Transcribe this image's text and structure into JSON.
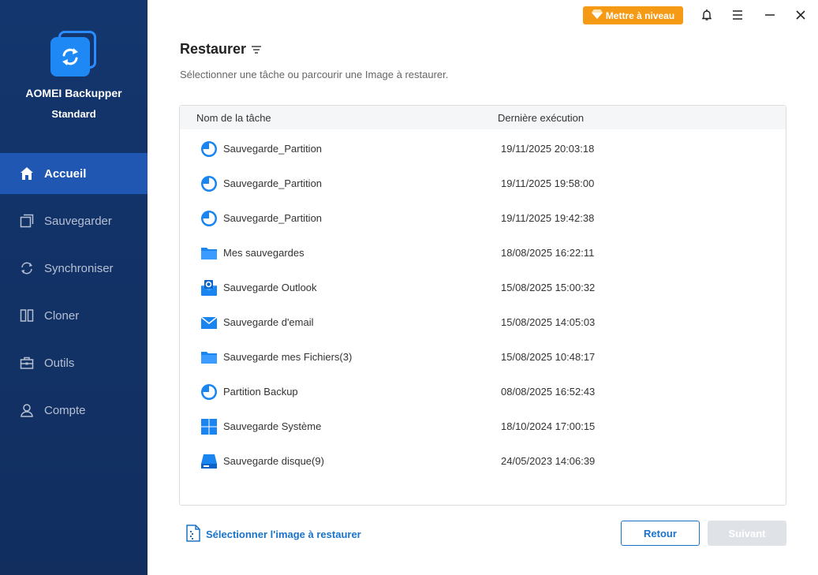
{
  "app": {
    "name": "AOMEI Backupper",
    "edition": "Standard"
  },
  "nav": [
    {
      "label": "Accueil",
      "icon": "home-icon",
      "active": true
    },
    {
      "label": "Sauvegarder",
      "icon": "backup-icon"
    },
    {
      "label": "Synchroniser",
      "icon": "sync-icon"
    },
    {
      "label": "Cloner",
      "icon": "clone-icon"
    },
    {
      "label": "Outils",
      "icon": "tools-icon"
    },
    {
      "label": "Compte",
      "icon": "user-icon"
    }
  ],
  "topbar": {
    "upgrade_label": "Mettre à niveau"
  },
  "main": {
    "title": "Restaurer",
    "subtitle": "Sélectionner une tâche ou parcourir une Image à restaurer.",
    "columns": {
      "name": "Nom de la tâche",
      "date": "Dernière exécution"
    },
    "rows": [
      {
        "name": "Sauvegarde_Partition",
        "date": "19/11/2025 20:03:18",
        "icon": "partition-icon"
      },
      {
        "name": "Sauvegarde_Partition",
        "date": "19/11/2025 19:58:00",
        "icon": "partition-icon"
      },
      {
        "name": "Sauvegarde_Partition",
        "date": "19/11/2025 19:42:38",
        "icon": "partition-icon"
      },
      {
        "name": "Mes sauvegardes",
        "date": "18/08/2025 16:22:11",
        "icon": "folder-icon"
      },
      {
        "name": "Sauvegarde Outlook",
        "date": "15/08/2025 15:00:32",
        "icon": "outlook-icon"
      },
      {
        "name": "Sauvegarde d'email",
        "date": "15/08/2025 14:05:03",
        "icon": "email-icon"
      },
      {
        "name": "Sauvegarde mes Fichiers(3)",
        "date": "15/08/2025 10:48:17",
        "icon": "folder-icon"
      },
      {
        "name": "Partition Backup",
        "date": "08/08/2025 16:52:43",
        "icon": "partition-icon"
      },
      {
        "name": "Sauvegarde Système",
        "date": "18/10/2024 17:00:15",
        "icon": "windows-icon"
      },
      {
        "name": "Sauvegarde disque(9)",
        "date": "24/05/2023 14:06:39",
        "icon": "disk-icon"
      }
    ],
    "select_image_label": "Sélectionner l'image à restaurer",
    "back_label": "Retour",
    "next_label": "Suivant"
  },
  "colors": {
    "sidebar": "#13366e",
    "accent": "#1a73c9",
    "upgrade": "#f59a14",
    "active_nav": "#1f57b3"
  }
}
